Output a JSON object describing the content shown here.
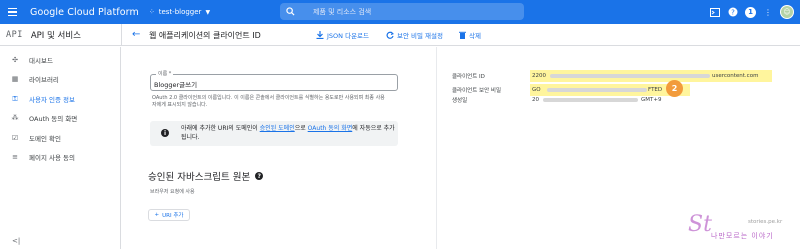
{
  "topbar": {
    "brand": "Google Cloud Platform",
    "project": "test-blogger",
    "search_placeholder": "제품 및 리소스 검색",
    "notifications_count": "1",
    "colors": {
      "bar": "#1a73e8"
    }
  },
  "subbar": {
    "api_logo": "API",
    "api_title": "API 및 서비스",
    "page_title": "웹 애플리케이션의 클라이언트 ID",
    "actions": {
      "json": "JSON 다운로드",
      "reset": "보안 비밀 재설정",
      "delete": "삭제"
    }
  },
  "sidebar": {
    "items": [
      {
        "label": "대시보드",
        "icon": "dashboard-icon"
      },
      {
        "label": "라이브러리",
        "icon": "library-icon"
      },
      {
        "label": "사용자 인증 정보",
        "icon": "key-icon",
        "active": true
      },
      {
        "label": "OAuth 동의 화면",
        "icon": "oauth-icon"
      },
      {
        "label": "도메인 확인",
        "icon": "checkbox-icon"
      },
      {
        "label": "페이지 사용 동의",
        "icon": "settings-list-icon"
      }
    ],
    "collapse_label": "<|"
  },
  "form": {
    "name_label": "이름 *",
    "name_value": "Blogger글쓰기",
    "help_text": "OAuth 2.0 클라이언트의 이름입니다. 이 이름은 콘솔에서 클라이언트를 식별하는 용도로만 사용되며 최종 사용자에게 표시되지 않습니다.",
    "note": {
      "prefix": "아래에 추가한 URI의 도메인이 ",
      "link1": "승인된 도메인",
      "middle": "으로 ",
      "link2": "OAuth 동의 화면",
      "suffix": "에 자동으로 추가됩니다."
    },
    "section_title": "승인된 자바스크립트 원본",
    "section_sub": "브라우저 요청에 사용",
    "add_uri": "URI 추가"
  },
  "details": {
    "client_id_label": "클라이언트 ID",
    "client_id_prefix": "2200",
    "client_id_suffix": "usercontent.com",
    "secret_label": "클라이언트 보안 비밀",
    "secret_prefix": "GO",
    "secret_suffix": "FTED",
    "created_label": "생성일",
    "created_prefix": "20",
    "created_suffix": "GMT+9",
    "badge": "2",
    "highlight_color": "#fff59d",
    "badge_color": "#f29b3c"
  },
  "watermark": {
    "logo": "St",
    "url": "stories.pe.kr",
    "name": "나만모르는 이야기"
  }
}
